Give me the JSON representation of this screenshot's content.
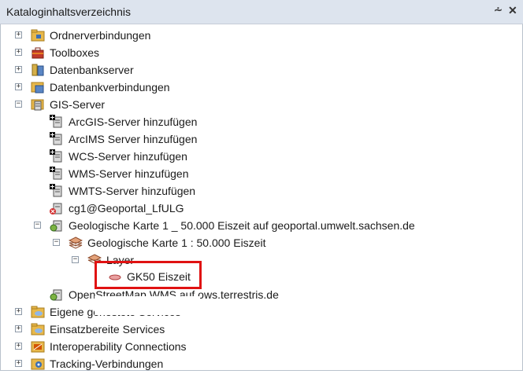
{
  "window": {
    "title": "Kataloginhaltsverzeichnis",
    "pin_glyph": "⩪",
    "close_glyph": "✕"
  },
  "tree": {
    "ordnerverbindungen": "Ordnerverbindungen",
    "toolboxes": "Toolboxes",
    "datenbankserver": "Datenbankserver",
    "datenbankverbindungen": "Datenbankverbindungen",
    "gis_server": "GIS-Server",
    "arcgis_add": "ArcGIS-Server hinzufügen",
    "arcims_add": "ArcIMS Server hinzufügen",
    "wcs_add": "WCS-Server hinzufügen",
    "wms_add": "WMS-Server hinzufügen",
    "wmts_add": "WMTS-Server hinzufügen",
    "cg1": "cg1@Geoportal_LfULG",
    "geo_karte_service": "Geologische Karte 1 _ 50.000 Eiszeit auf geoportal.umwelt.sachsen.de",
    "geo_karte": "Geologische Karte 1 : 50.000 Eiszeit",
    "layer": "Layer",
    "gk50": "GK50 Eiszeit",
    "openstreetmap": "OpenStreetMap WMS auf ows.terrestris.de",
    "eigene_services": "Eigene gehostete Services",
    "einsatzbereite_services": "Einsatzbereite Services",
    "interoperability": "Interoperability Connections",
    "tracking": "Tracking-Verbindungen"
  },
  "colors": {
    "highlight": "#e01212",
    "folder": "#e8b84a",
    "server_blue": "#3b6fb6"
  }
}
